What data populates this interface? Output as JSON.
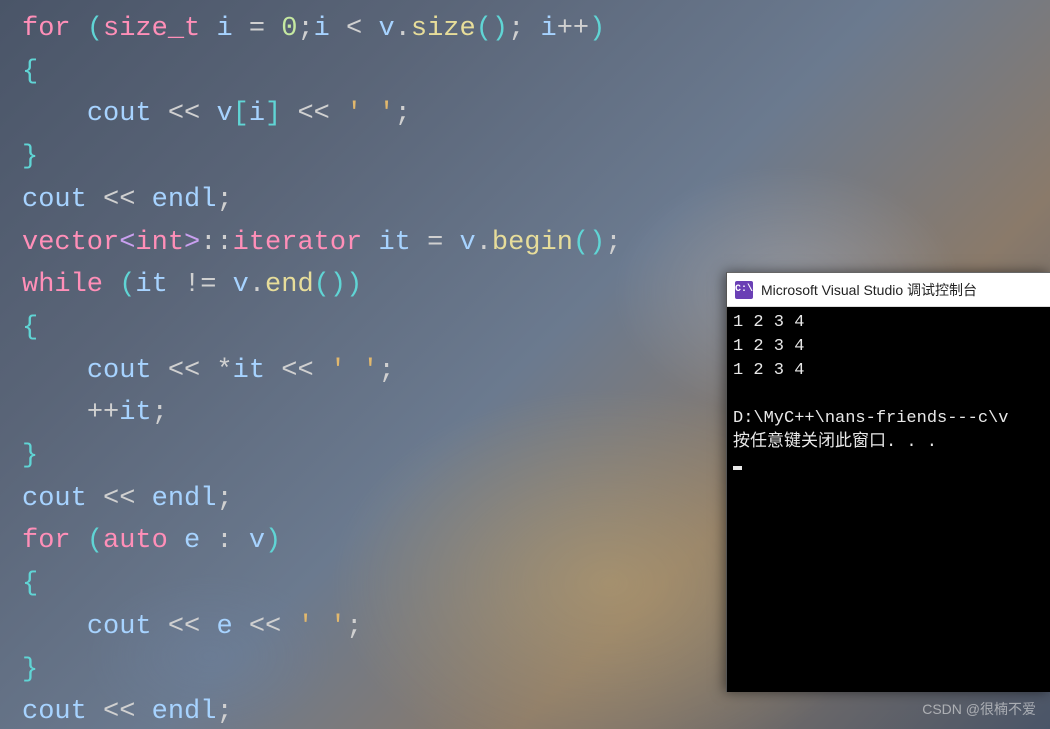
{
  "code": {
    "tokens": [
      [
        {
          "t": "keyword",
          "v": "for"
        },
        {
          "t": "op",
          "v": " "
        },
        {
          "t": "brace",
          "v": "("
        },
        {
          "t": "type",
          "v": "size_t"
        },
        {
          "t": "op",
          "v": " "
        },
        {
          "t": "ident",
          "v": "i"
        },
        {
          "t": "op",
          "v": " = "
        },
        {
          "t": "number",
          "v": "0"
        },
        {
          "t": "op",
          "v": ";"
        },
        {
          "t": "ident",
          "v": "i"
        },
        {
          "t": "op",
          "v": " < "
        },
        {
          "t": "ident",
          "v": "v"
        },
        {
          "t": "op",
          "v": "."
        },
        {
          "t": "call",
          "v": "size"
        },
        {
          "t": "brace",
          "v": "()"
        },
        {
          "t": "op",
          "v": "; "
        },
        {
          "t": "ident",
          "v": "i"
        },
        {
          "t": "op",
          "v": "++"
        },
        {
          "t": "brace",
          "v": ")"
        }
      ],
      [
        {
          "t": "brace",
          "v": "{"
        }
      ],
      [
        {
          "t": "guide",
          "v": "    "
        },
        {
          "t": "ident",
          "v": "cout"
        },
        {
          "t": "op",
          "v": " << "
        },
        {
          "t": "ident",
          "v": "v"
        },
        {
          "t": "brace",
          "v": "["
        },
        {
          "t": "ident",
          "v": "i"
        },
        {
          "t": "brace",
          "v": "]"
        },
        {
          "t": "op",
          "v": " << "
        },
        {
          "t": "char",
          "v": "' '"
        },
        {
          "t": "op",
          "v": ";"
        }
      ],
      [
        {
          "t": "brace",
          "v": "}"
        }
      ],
      [
        {
          "t": "ident",
          "v": "cout"
        },
        {
          "t": "op",
          "v": " << "
        },
        {
          "t": "ident",
          "v": "endl"
        },
        {
          "t": "op",
          "v": ";"
        }
      ],
      [
        {
          "t": "type",
          "v": "vector"
        },
        {
          "t": "angle",
          "v": "<"
        },
        {
          "t": "type",
          "v": "int"
        },
        {
          "t": "angle",
          "v": ">"
        },
        {
          "t": "op",
          "v": "::"
        },
        {
          "t": "type",
          "v": "iterator"
        },
        {
          "t": "op",
          "v": " "
        },
        {
          "t": "ident",
          "v": "it"
        },
        {
          "t": "op",
          "v": " = "
        },
        {
          "t": "ident",
          "v": "v"
        },
        {
          "t": "op",
          "v": "."
        },
        {
          "t": "call",
          "v": "begin"
        },
        {
          "t": "brace",
          "v": "()"
        },
        {
          "t": "op",
          "v": ";"
        }
      ],
      [
        {
          "t": "keyword",
          "v": "while"
        },
        {
          "t": "op",
          "v": " "
        },
        {
          "t": "brace",
          "v": "("
        },
        {
          "t": "ident",
          "v": "it"
        },
        {
          "t": "op",
          "v": " != "
        },
        {
          "t": "ident",
          "v": "v"
        },
        {
          "t": "op",
          "v": "."
        },
        {
          "t": "call",
          "v": "end"
        },
        {
          "t": "brace",
          "v": "()"
        },
        {
          "t": "brace",
          "v": ")"
        }
      ],
      [
        {
          "t": "brace",
          "v": "{"
        }
      ],
      [
        {
          "t": "guide",
          "v": "    "
        },
        {
          "t": "ident",
          "v": "cout"
        },
        {
          "t": "op",
          "v": " << *"
        },
        {
          "t": "ident",
          "v": "it"
        },
        {
          "t": "op",
          "v": " << "
        },
        {
          "t": "char",
          "v": "' '"
        },
        {
          "t": "op",
          "v": ";"
        }
      ],
      [
        {
          "t": "guide",
          "v": "    "
        },
        {
          "t": "op",
          "v": "++"
        },
        {
          "t": "ident",
          "v": "it"
        },
        {
          "t": "op",
          "v": ";"
        }
      ],
      [
        {
          "t": "brace",
          "v": "}"
        }
      ],
      [
        {
          "t": "ident",
          "v": "cout"
        },
        {
          "t": "op",
          "v": " << "
        },
        {
          "t": "ident",
          "v": "endl"
        },
        {
          "t": "op",
          "v": ";"
        }
      ],
      [
        {
          "t": "keyword",
          "v": "for"
        },
        {
          "t": "op",
          "v": " "
        },
        {
          "t": "brace",
          "v": "("
        },
        {
          "t": "keyword",
          "v": "auto"
        },
        {
          "t": "op",
          "v": " "
        },
        {
          "t": "ident",
          "v": "e"
        },
        {
          "t": "op",
          "v": " : "
        },
        {
          "t": "ident",
          "v": "v"
        },
        {
          "t": "brace",
          "v": ")"
        }
      ],
      [
        {
          "t": "brace",
          "v": "{"
        }
      ],
      [
        {
          "t": "guide",
          "v": "    "
        },
        {
          "t": "ident",
          "v": "cout"
        },
        {
          "t": "op",
          "v": " << "
        },
        {
          "t": "ident",
          "v": "e"
        },
        {
          "t": "op",
          "v": " << "
        },
        {
          "t": "char",
          "v": "' '"
        },
        {
          "t": "op",
          "v": ";"
        }
      ],
      [
        {
          "t": "brace",
          "v": "}"
        }
      ],
      [
        {
          "t": "ident",
          "v": "cout"
        },
        {
          "t": "op",
          "v": " << "
        },
        {
          "t": "ident",
          "v": "endl"
        },
        {
          "t": "op",
          "v": ";"
        }
      ]
    ]
  },
  "console": {
    "icon_text": "C:\\",
    "title": "Microsoft Visual Studio 调试控制台",
    "lines": [
      "1 2 3 4",
      "1 2 3 4",
      "1 2 3 4",
      "",
      "D:\\MyC++\\nans-friends---c\\v",
      "按任意键关闭此窗口. . ."
    ]
  },
  "watermark": "CSDN @很楠不爱"
}
